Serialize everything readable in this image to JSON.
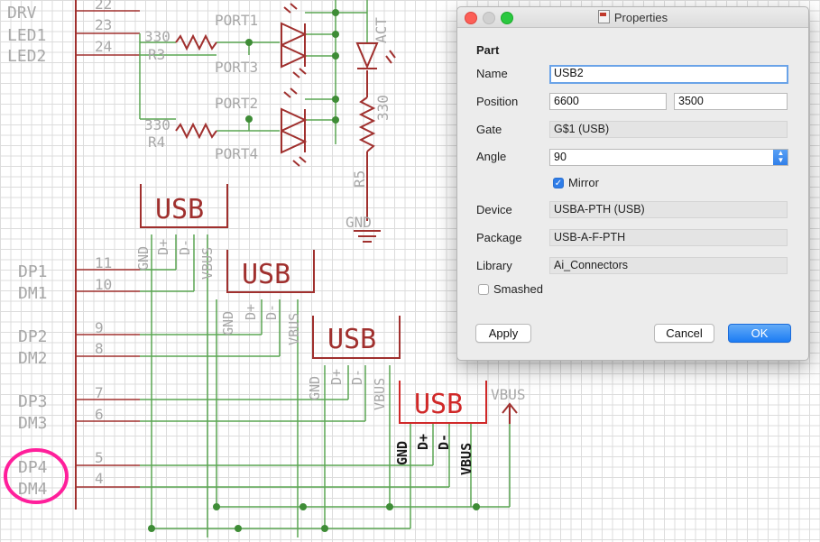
{
  "schematic": {
    "pin_labels_left": [
      "DRV",
      "LED1",
      "LED2",
      "DP1",
      "DM1",
      "DP2",
      "DM2",
      "DP3",
      "DM3",
      "DP4",
      "DM4"
    ],
    "pin_numbers": [
      "22",
      "23",
      "24",
      "11",
      "10",
      "9",
      "8",
      "7",
      "6",
      "5",
      "4"
    ],
    "resistors": [
      {
        "value": "330",
        "name": "R3"
      },
      {
        "value": "330",
        "name": "R4"
      },
      {
        "value": "330",
        "name": "R5"
      }
    ],
    "port_labels": [
      "PORT1",
      "PORT3",
      "PORT2",
      "PORT4"
    ],
    "act_label": "ACT",
    "gnd_label": "GND",
    "vbus_label": "VBUS",
    "usb_parts": [
      {
        "title": "USB",
        "pins": [
          "GND",
          "D+",
          "D-",
          "VBUS"
        ]
      },
      {
        "title": "USB",
        "pins": [
          "GND",
          "D+",
          "D-",
          "VBUS"
        ]
      },
      {
        "title": "USB",
        "pins": [
          "GND",
          "D+",
          "D-",
          "VBUS"
        ]
      },
      {
        "title": "USB",
        "pins": [
          "GND",
          "D+",
          "D-",
          "VBUS"
        ]
      }
    ],
    "colors": {
      "part": "#a0302e",
      "net": "#5aa552",
      "junction": "#3e8c36",
      "pin_text": "#a8a8a8",
      "selected_part": "#d02828",
      "annotation": "#ff1f9b",
      "grid": "#dcdcdc"
    }
  },
  "dialog": {
    "title": "Properties",
    "section": "Part",
    "name": {
      "label": "Name",
      "value": "USB2"
    },
    "position": {
      "label": "Position",
      "x": "6600",
      "y": "3500"
    },
    "gate": {
      "label": "Gate",
      "value": "G$1 (USB)"
    },
    "angle": {
      "label": "Angle",
      "value": "90"
    },
    "mirror": {
      "label": "Mirror",
      "checked": true
    },
    "device": {
      "label": "Device",
      "value": "USBA-PTH (USB)"
    },
    "package": {
      "label": "Package",
      "value": "USB-A-F-PTH"
    },
    "library": {
      "label": "Library",
      "value": "Ai_Connectors"
    },
    "smashed": {
      "label": "Smashed",
      "checked": false
    },
    "buttons": {
      "apply": "Apply",
      "cancel": "Cancel",
      "ok": "OK"
    }
  }
}
